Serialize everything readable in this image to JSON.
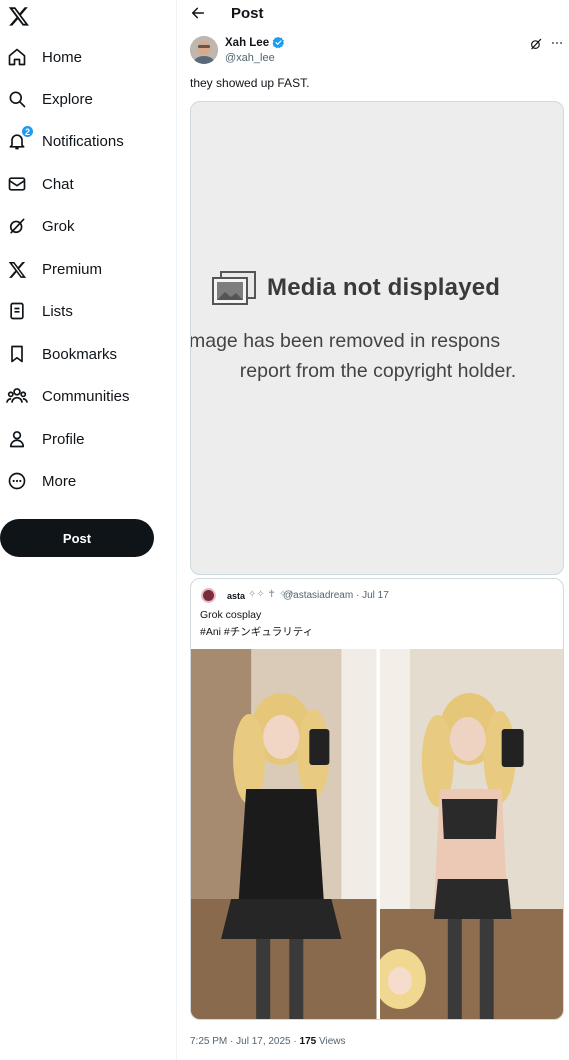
{
  "nav": {
    "items": [
      {
        "label": "Home",
        "icon": "home-icon"
      },
      {
        "label": "Explore",
        "icon": "search-icon"
      },
      {
        "label": "Notifications",
        "icon": "bell-icon",
        "badge": "2"
      },
      {
        "label": "Chat",
        "icon": "envelope-icon"
      },
      {
        "label": "Grok",
        "icon": "grok-icon"
      },
      {
        "label": "Premium",
        "icon": "x-logo-icon"
      },
      {
        "label": "Lists",
        "icon": "list-icon"
      },
      {
        "label": "Bookmarks",
        "icon": "bookmark-icon"
      },
      {
        "label": "Communities",
        "icon": "people-icon"
      },
      {
        "label": "Profile",
        "icon": "person-icon"
      },
      {
        "label": "More",
        "icon": "more-circle-icon"
      }
    ],
    "post_button": "Post"
  },
  "header": {
    "title": "Post"
  },
  "tweet": {
    "author_name": "Xah Lee",
    "author_handle": "@xah_lee",
    "text": "they showed up FAST.",
    "media": {
      "heading": "Media not displayed",
      "line1": "mage has been removed in respons",
      "line2": "report from the copyright holder."
    },
    "quote": {
      "name": "asta",
      "decoration": "✧✧ ✝ ✧✧",
      "handle_date": "@astasiadream · Jul 17",
      "line1": "Grok cosplay",
      "line2": "#Ani #チンギュラリティ"
    },
    "time": "7:25 PM · Jul 17, 2025 · ",
    "views_count": "175",
    "views_label": " Views"
  },
  "colors": {
    "accent": "#1d9bf0",
    "text": "#0f1419",
    "secondary_text": "#536471",
    "media_bg": "#ededed",
    "post_button_bg": "#0f1419"
  }
}
